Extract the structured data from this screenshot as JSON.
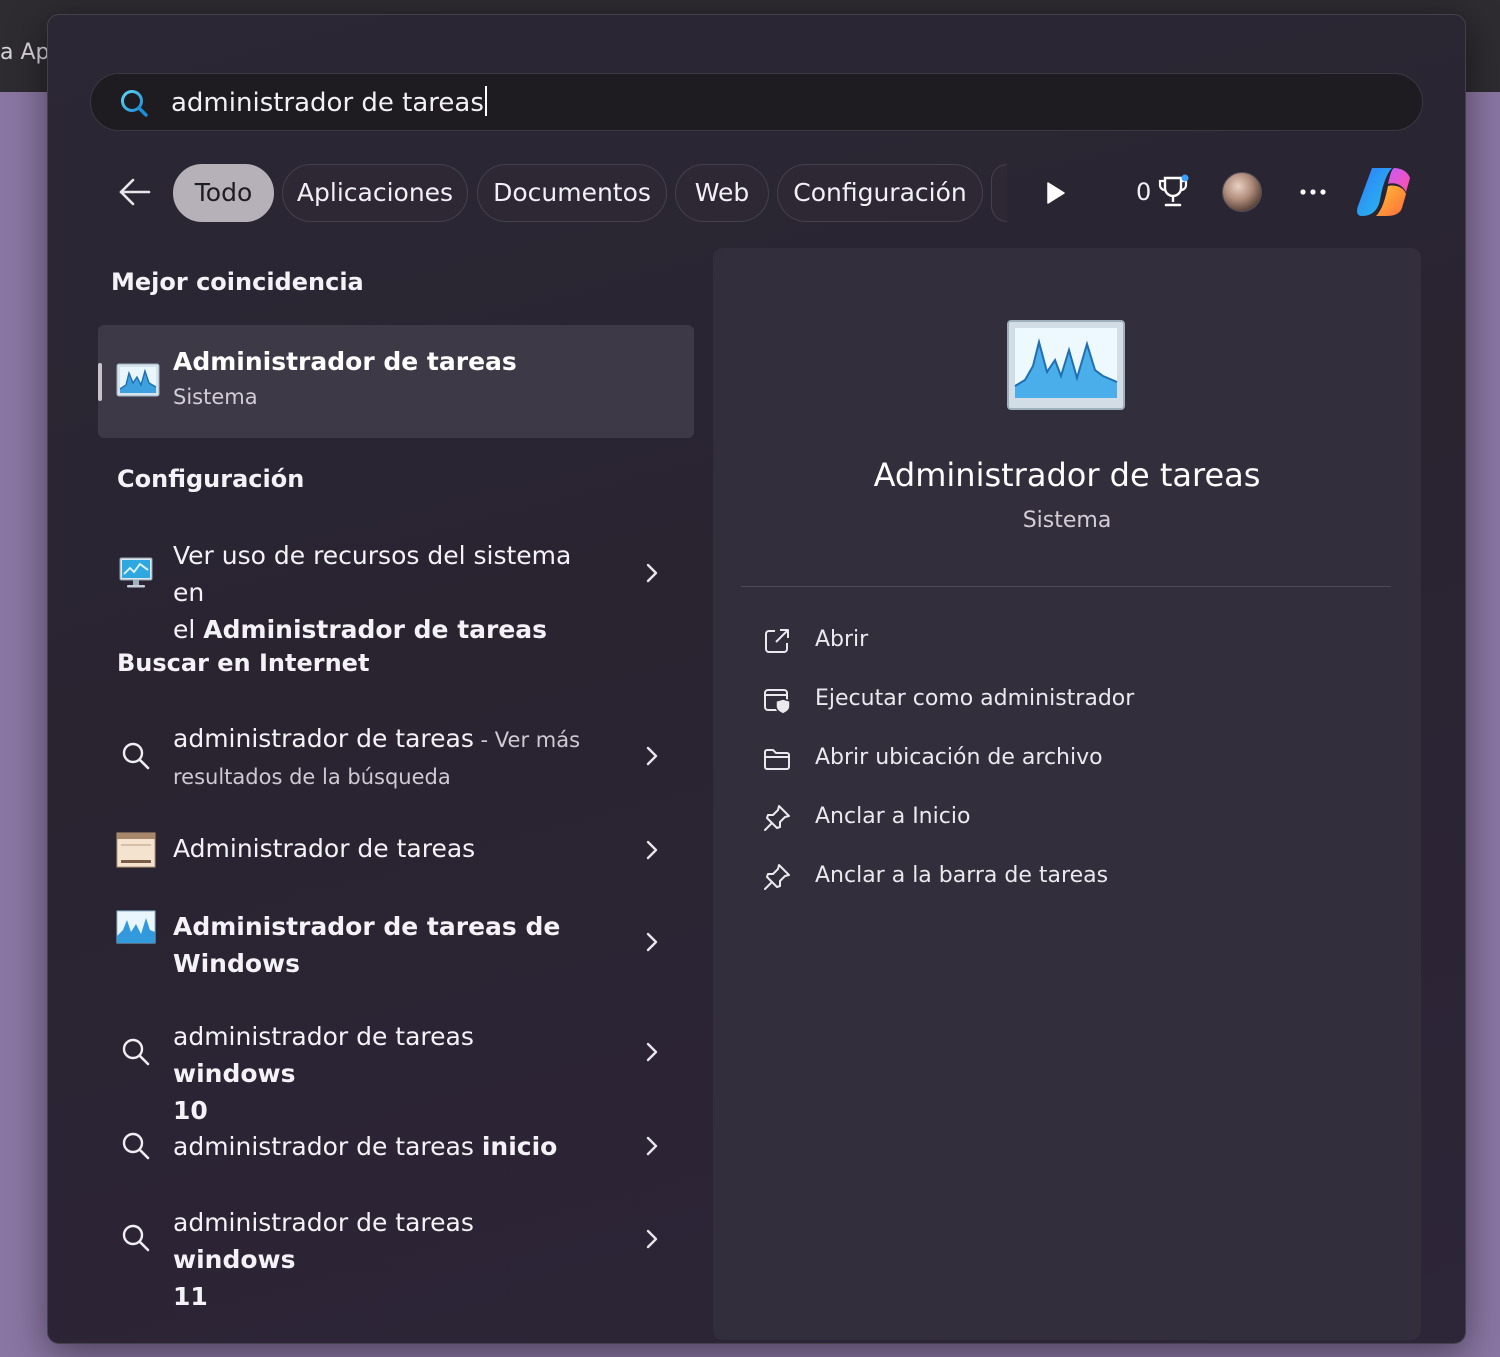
{
  "background": {
    "edge_title": "a Ap"
  },
  "search": {
    "query": "administrador de tareas"
  },
  "filters": {
    "tabs": [
      {
        "label": "Todo",
        "active": true
      },
      {
        "label": "Aplicaciones"
      },
      {
        "label": "Documentos"
      },
      {
        "label": "Web"
      },
      {
        "label": "Configuración"
      }
    ],
    "rewards_count": "0"
  },
  "sections": {
    "best_match": "Mejor coincidencia",
    "settings": "Configuración",
    "web": "Buscar en Internet"
  },
  "best_match": {
    "title": "Administrador de tareas",
    "subtitle": "Sistema"
  },
  "settings_result": {
    "line1": "Ver uso de recursos del sistema en",
    "line2_prefix": "el ",
    "line2_bold": "Administrador de tareas"
  },
  "web_results": [
    {
      "text": "administrador de tareas",
      "suffix": " - Ver más",
      "line2": "resultados de la búsqueda"
    },
    {
      "text": "Administrador de tareas"
    },
    {
      "text": "Administrador de tareas de",
      "line2": "Windows"
    },
    {
      "text": "administrador de tareas ",
      "bold": "windows",
      "line2": "10"
    },
    {
      "text": "administrador de tareas ",
      "bold": "inicio"
    },
    {
      "text": "administrador de tareas ",
      "bold": "windows",
      "line2": "11"
    }
  ],
  "preview": {
    "title": "Administrador de tareas",
    "subtitle": "Sistema",
    "actions": [
      {
        "label": "Abrir",
        "icon": "open-external-icon"
      },
      {
        "label": "Ejecutar como administrador",
        "icon": "run-as-admin-icon"
      },
      {
        "label": "Abrir ubicación de archivo",
        "icon": "folder-icon"
      },
      {
        "label": "Anclar a Inicio",
        "icon": "pin-icon"
      },
      {
        "label": "Anclar a la barra de tareas",
        "icon": "pin-icon"
      }
    ]
  },
  "colors": {
    "accent_search": "#2bb8e6",
    "panel": "#2a2431",
    "chip_active": "#b6b0b9"
  }
}
